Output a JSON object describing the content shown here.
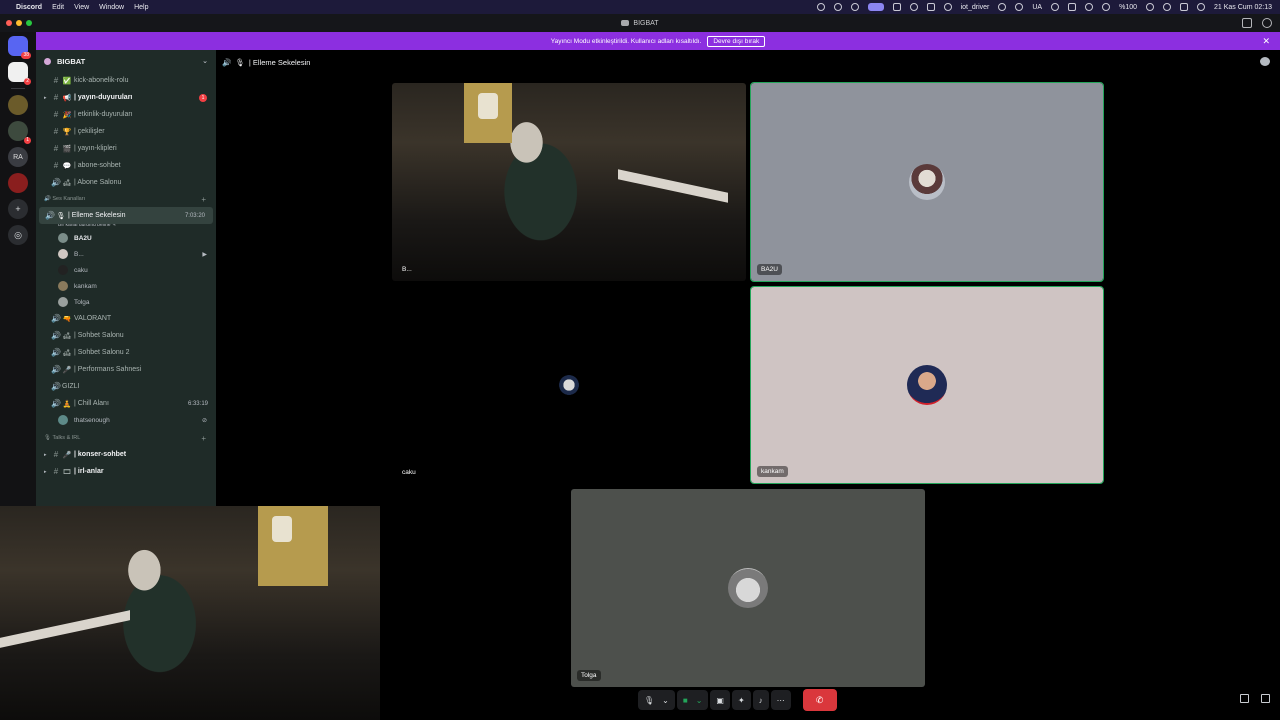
{
  "menubar": {
    "apple": "",
    "items": [
      "Discord",
      "Edit",
      "View",
      "Window",
      "Help"
    ],
    "right": {
      "user": "iot_driver",
      "lang": "UA",
      "battery": "%100",
      "datetime": "21 Kas Cum 02:13"
    }
  },
  "window": {
    "title": "BIGBAT"
  },
  "banner": {
    "text": "Yayıncı Modu etkinleştirildi. Kullanıcı adları kısaltıldı.",
    "button": "Devre dışı bırak",
    "close": "✕"
  },
  "rail": {
    "home_badge": "38",
    "badges": [
      "2",
      "1"
    ],
    "initials": "RA",
    "add": "+",
    "discover": "◎"
  },
  "sidebar": {
    "guild_name": "BIGBAT",
    "guild_chevron": "⌄",
    "text_channels": [
      {
        "name": "kick-abonelik-rolu",
        "emoji": "✅",
        "icon": "hash"
      },
      {
        "name": "| yayın-duyuruları",
        "emoji": "📢",
        "icon": "hash",
        "unread": true,
        "mentions": "1"
      },
      {
        "name": "| etkinlik-duyuruları",
        "emoji": "🎉",
        "icon": "hash"
      },
      {
        "name": "| çekilişler",
        "emoji": "🏆",
        "icon": "hash"
      },
      {
        "name": "| yayın-klipleri",
        "emoji": "🎬",
        "icon": "hash"
      },
      {
        "name": "| abone-sohbet",
        "emoji": "💬",
        "icon": "hash"
      },
      {
        "name": "| Abone Salonu",
        "emoji": "🛋",
        "icon": "voice"
      }
    ],
    "voice_category": {
      "name": "Ses Kanalları",
      "plus": "+"
    },
    "active_channel": {
      "name": "| Elleme Sekelesin",
      "emoji": "🎙",
      "time": "7:03:20",
      "status": "Bir kanal durumu belirle ✎"
    },
    "members": [
      {
        "name": "BA2U",
        "bold": true
      },
      {
        "name": "B...",
        "bold": false,
        "camera": "▶"
      },
      {
        "name": "caku",
        "bold": false
      },
      {
        "name": "kankam",
        "bold": false
      },
      {
        "name": "Tolga",
        "bold": false
      }
    ],
    "voice_channels": [
      {
        "name": "VALORANT",
        "emoji": "🔫"
      },
      {
        "name": "| Sohbet Salonu",
        "emoji": "🛋"
      },
      {
        "name": "| Sohbet Salonu 2",
        "emoji": "🛋"
      },
      {
        "name": "| Performans Sahnesi",
        "emoji": "🎤"
      },
      {
        "name": "GIZLI",
        "emoji": ""
      },
      {
        "name": "| Chill Alanı",
        "emoji": "🧘",
        "time": "6:33:19"
      }
    ],
    "chill_member": {
      "name": "thatsenough",
      "deaf": "⊘"
    },
    "talks_category": {
      "name": "Talks & IRL",
      "plus": "+"
    },
    "talks_channels": [
      {
        "name": "| konser-sohbet",
        "emoji": "🎤",
        "unread": true
      },
      {
        "name": "| irl-anlar",
        "emoji": "🎞",
        "unread": true
      }
    ]
  },
  "call": {
    "header": "| Elleme Sekelesin",
    "header_emoji": "🎙",
    "tiles": [
      {
        "label": "B..."
      },
      {
        "label": "BA2U"
      },
      {
        "label": "caku"
      },
      {
        "label": "kankam"
      },
      {
        "label": "Tolga"
      }
    ]
  },
  "controls": {
    "mic": "🎙",
    "mic_chevron": "⌄",
    "camera": "■",
    "camera_chevron": "⌄",
    "screen": "▣",
    "activities": "✦",
    "soundboard": "♪",
    "more": "⋯",
    "hangup": "✆"
  },
  "colors": {
    "accent": "#5865f2",
    "banner": "#8c2fe0",
    "speaking": "#23a55a",
    "danger": "#da373c",
    "sidebar": "#1f2b28"
  }
}
